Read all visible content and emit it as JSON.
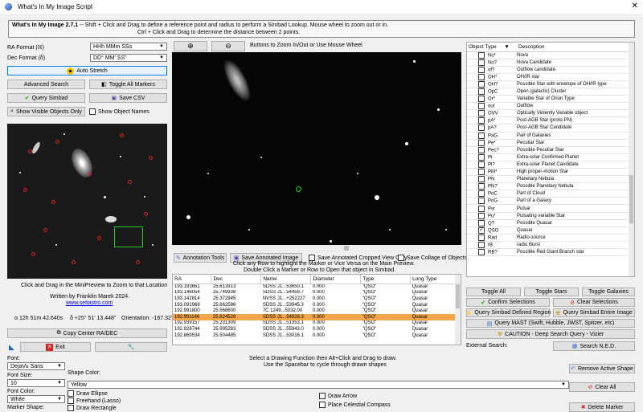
{
  "window": {
    "title": "What's In My Image Script"
  },
  "header": {
    "app_name": "What's In My Image 2.7.1",
    "line1": " -- Shift + Click and Drag to define a reference point and radius to perform a Simbad Lookup. Mouse wheel to zoom out or in.",
    "line2": "Ctrl + Click and Drag to determine the distance between 2 points."
  },
  "left": {
    "ra_format_label": "RA Format (ℍ)",
    "ra_format_value": "HHh MMm SSs",
    "dec_format_label": "Dec Format (δ)",
    "dec_format_value": "DD° MM' SS\"",
    "auto_stretch": "Auto Stretch",
    "advanced_search": "Advanced Search",
    "toggle_all_markers": "Toggle All Markers",
    "query_simbad": "Query Simbad",
    "save_csv": "Save CSV",
    "show_visible": "Show Visible Objects Only",
    "show_names": "Show Object Names",
    "mini_caption": "Click and Drag in the MiniPreview to Zoom to that Location",
    "written_by": "Written by Franklin Marek 2024.",
    "website": "www.setiastro.com",
    "ra_coord": "α  12h 51m 42.640s",
    "dec_coord": "δ  +25° 51' 13.448\"",
    "orientation": "Orientation: -167.32°",
    "copy_center": "Copy Center RA/DEC",
    "exit": "Exit"
  },
  "center": {
    "zoom_caption": "Buttons to Zoom In/Out or Use Mouse Wheel",
    "annotation_tools": "Annotation Tools",
    "save_annotated": "Save Annotated Image",
    "save_cropped": "Save Annotated Cropped View Only",
    "save_collage": "Save Collage of Objects",
    "click_hint1": "Click any Row to highlight the Marker or Vice Versa on the Main Preview.",
    "click_hint2": "Double Click a Marker or Row to Open that object in Simbad.",
    "columns": [
      "RA",
      "Dec",
      "Name",
      "Diameter",
      "Type",
      "Long Type"
    ],
    "rows": [
      [
        "193.193651",
        "25.613913",
        "SDSS J1...53650.1",
        "0.000",
        "\"QSO\"",
        "Quasar"
      ],
      [
        "193.146054",
        "25.749938",
        "SDSS J1...54459.7",
        "0.000",
        "\"QSO\"",
        "Quasar"
      ],
      [
        "193.142814",
        "25.372945",
        "NVSS J1...+252227",
        "0.000",
        "\"QSO\"",
        "Quasar"
      ],
      [
        "193.091968",
        "25.662586",
        "SDSS J1...53945.3",
        "0.000",
        "\"QSO\"",
        "Quasar"
      ],
      [
        "192.991800",
        "25.568600",
        "7C 1249...5032.00",
        "0.000",
        "\"QSO\"",
        "Quasar"
      ],
      [
        "192.991146",
        "25.824529",
        "SDSS J1...54928.3",
        "0.000",
        "\"QSO\"",
        "Quasar"
      ],
      [
        "192.939157",
        "25.231309",
        "SDSS J1...51353.1",
        "0.000",
        "\"QSO\"",
        "Quasar"
      ],
      [
        "192.928744",
        "25.995283",
        "SDSS J1...55943.0",
        "0.000",
        "\"QSO\"",
        "Quasar"
      ],
      [
        "192.869534",
        "25.504485",
        "SDSS J1...53016.1",
        "0.000",
        "\"QSO\"",
        "Quasar"
      ]
    ],
    "selected_row": 5
  },
  "right": {
    "col_type": "Object Type",
    "col_desc": "Description",
    "types": [
      {
        "code": "No*",
        "desc": "Nova",
        "checked": false
      },
      {
        "code": "No?",
        "desc": "Nova Candidate",
        "checked": false
      },
      {
        "code": "of?",
        "desc": "Outflow candidate",
        "checked": false
      },
      {
        "code": "OH*",
        "desc": "OH/IR star",
        "checked": false
      },
      {
        "code": "OH?",
        "desc": "Possible Star with envelope of OH/IR type",
        "checked": false
      },
      {
        "code": "OpC",
        "desc": "Open (galactic) Cluster",
        "checked": false
      },
      {
        "code": "Or*",
        "desc": "Variable Star of Orion Type",
        "checked": false
      },
      {
        "code": "out",
        "desc": "Outflow",
        "checked": false
      },
      {
        "code": "OVV",
        "desc": "Optically Violently Variable object",
        "checked": false
      },
      {
        "code": "pA*",
        "desc": "Post-AGB Star (proto-PN)",
        "checked": false
      },
      {
        "code": "pA?",
        "desc": "Post-AGB Star Candidate",
        "checked": false
      },
      {
        "code": "PaG",
        "desc": "Pair of Galaxies",
        "checked": false
      },
      {
        "code": "Pe*",
        "desc": "Peculiar Star",
        "checked": false
      },
      {
        "code": "Pec?",
        "desc": "Possible Peculiar Star",
        "checked": false
      },
      {
        "code": "Pl",
        "desc": "Extra-solar Confirmed Planet",
        "checked": false
      },
      {
        "code": "Pl?",
        "desc": "Extra-solar Planet Candidate",
        "checked": false
      },
      {
        "code": "PM*",
        "desc": "High proper-motion Star",
        "checked": false
      },
      {
        "code": "PN",
        "desc": "Planetary Nebula",
        "checked": false
      },
      {
        "code": "PN?",
        "desc": "Possible Planetary Nebula",
        "checked": false
      },
      {
        "code": "PoC",
        "desc": "Part of Cloud",
        "checked": false
      },
      {
        "code": "PoG",
        "desc": "Part of a Galaxy",
        "checked": false
      },
      {
        "code": "Psr",
        "desc": "Pulsar",
        "checked": false
      },
      {
        "code": "Pu*",
        "desc": "Pulsating variable Star",
        "checked": false
      },
      {
        "code": "Q?",
        "desc": "Possible Quasar",
        "checked": false
      },
      {
        "code": "QSO",
        "desc": "Quasar",
        "checked": true
      },
      {
        "code": "Rad",
        "desc": "Radio-source",
        "checked": false
      },
      {
        "code": "rB",
        "desc": "radio Burst",
        "checked": false
      },
      {
        "code": "RB?",
        "desc": "Possible Red Giant Branch star",
        "checked": false
      }
    ],
    "toggle_all": "Toggle All",
    "toggle_stars": "Toggle Stars",
    "toggle_galaxies": "Toggle Galaxies",
    "confirm_selections": "Confirm Selections",
    "clear_selections": "Clear Selections",
    "query_defined": "Query Simbad Defined Region",
    "query_entire": "Query Simbad Entire Image",
    "query_mast": "Query MAST (Swift, Hubble, JWST, Spitzer, etc)",
    "deep_search": "CAUTION - Deep Search Query - Vizier",
    "external_search": "External Search:",
    "search_ned": "Search N.E.D."
  },
  "bottom": {
    "font_label": "Font:",
    "font_value": "DejaVu Sans",
    "font_size_label": "Font Size:",
    "font_size_value": "10",
    "font_color_label": "Font Color:",
    "font_color_value": "White",
    "marker_shape_label": "Marker Shape:",
    "shape_color_label": "Shape Color:",
    "shape_color_value": "Yellow",
    "draw_hint1": "Select a Drawing Function then Alt+Click and Drag to draw.",
    "draw_hint2": "Use the Spacebar to cycle through drawn shapes",
    "draw_ellipse": "Draw Ellipse",
    "freehand": "Freehand (Lasso)",
    "draw_rectangle": "Draw Rectangle",
    "draw_arrow": "Draw Arrow",
    "place_compass": "Place Celestial Compass",
    "remove_shape": "Remove Active Shape",
    "clear_all": "Clear All",
    "delete_marker": "Delete Marker"
  },
  "colors": {
    "accent": "#0078d7",
    "selected_row": "#f5a54a",
    "quasar_marker": "#22cc22",
    "red_marker": "#e02020"
  }
}
